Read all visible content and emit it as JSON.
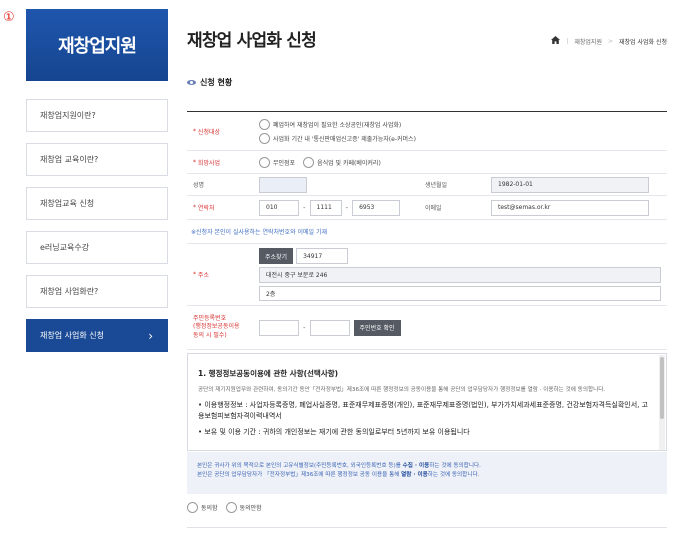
{
  "marker": "①",
  "sidebar": {
    "title": "재창업지원",
    "items": [
      {
        "label": "재창업지원이란?"
      },
      {
        "label": "재창업 교육이란?"
      },
      {
        "label": "재창업교육 신청"
      },
      {
        "label": "e러닝교육수강"
      },
      {
        "label": "재창업 사업화란?"
      },
      {
        "label": "재창업 사업화 신청",
        "active": true
      }
    ],
    "active_chevron": "›"
  },
  "header": {
    "title": "재창업 사업화 신청",
    "breadcrumb": [
      "재창업지원",
      "재창업 사업화 신청"
    ],
    "breadcrumb_sep": ">"
  },
  "section": {
    "title": "신청 현황"
  },
  "form": {
    "target": {
      "label": "신청대상",
      "options": [
        "폐업하여 재창업이 필요한 소상공인(재창업 사업화)",
        "사업화 기간 내 '통신판매업신고증' 제출가능자(e-커머스)"
      ]
    },
    "business": {
      "label": "희망사업",
      "options": [
        "무인점포",
        "음식업 및 카페(베이커리)"
      ]
    },
    "name": {
      "label": "성명",
      "value": ""
    },
    "birth": {
      "label": "생년월일",
      "value": "1982-01-01"
    },
    "phone": {
      "label": "연락처",
      "p1": "010",
      "p2": "1111",
      "p3": "6953"
    },
    "email": {
      "label": "이메일",
      "value": "test@semas.or.kr"
    },
    "hint": "※신청자 본인이 실사용하는 연락처번호와 이메일 기재",
    "address": {
      "label": "주소",
      "search_button": "주소찾기",
      "zip": "34917",
      "line1": "대전시 중구 보문로 246",
      "line2": "2층"
    },
    "rrn": {
      "label_lines": [
        "주민등록번호",
        "(행정정보공동이용",
        "동의 시 필수)"
      ],
      "confirm_button": "주민번호 확인",
      "p1": "",
      "p2": ""
    }
  },
  "terms": {
    "heading": "1. 행정정보공동이용에 관한 사항(선택사항)",
    "intro": "공단의 재기지원업무와 관련하여, 동의기간 동안「전자정부법」제36조에 따른 행정정보의 공동이용을 통해 공단의 업무담당자가 행정정보를 열람 · 이용하는 것에 동의합니다.",
    "bullet1": "• 이용행정정보 : 사업자등록증명, 폐업사실증명, 표준재무제표증명(개인), 표준재무제표증명(법인), 부가가치세과세표준증명, 건강보험자격득실확인서, 고용보험피보험자격이력내역서",
    "bullet2": "• 보유 및 이용 기간 : 귀하의 개인정보는 재기에 관한 동의일로부터 5년까지 보유 이용됩니다"
  },
  "notice": {
    "line1_pre": "본인은 귀사가 위의 목적으로 본인의 고유식별정보(주민등록번호, 외국인등록번호 등)를 ",
    "line1_bold": "수집 · 이용",
    "line1_post": "하는 것에 동의합니다.",
    "line2_pre": "본인은 공단의 업무담당자가 「전자정부법」제36조에 따른 행정정보 공동 이용을 통해 ",
    "line2_bold": "열람 · 이용",
    "line2_post": "하는 것에 동의합니다."
  },
  "agree": {
    "yes": "동의함",
    "no": "동의안함"
  }
}
